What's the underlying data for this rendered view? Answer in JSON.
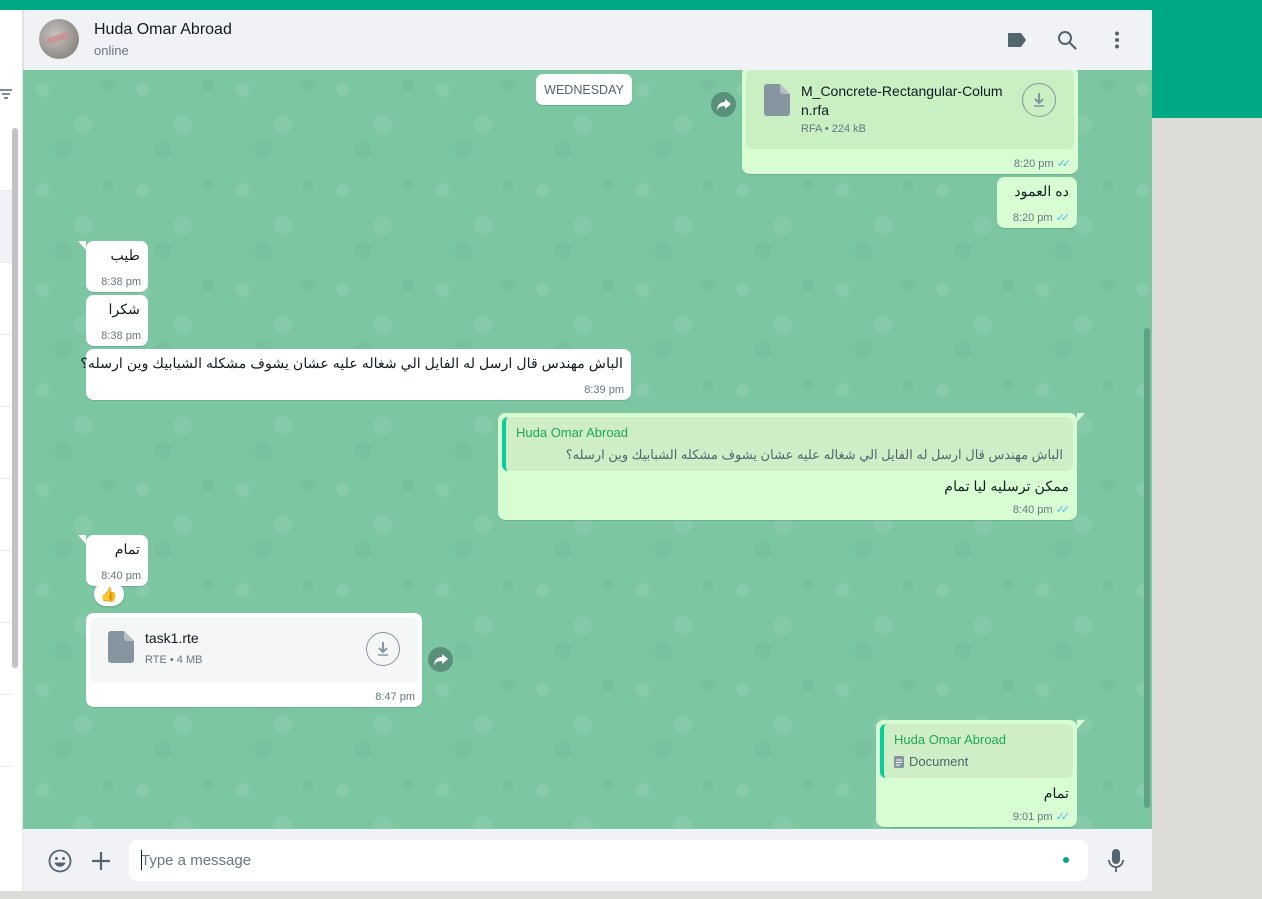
{
  "colors": {
    "accent": "#00a884",
    "incoming_bubble": "#ffffff",
    "outgoing_bubble": "#d9fdd3",
    "wallpaper": "#7cc6a2",
    "read_ticks": "#53bdeb",
    "quote_name": "#1fa855"
  },
  "header": {
    "contact_name": "Huda Omar Abroad",
    "status": "online",
    "icons": [
      "label-icon",
      "search-icon",
      "menu-icon"
    ]
  },
  "date_chip": "WEDNESDAY",
  "messages": [
    {
      "id": "m1",
      "direction": "out",
      "type": "document",
      "file_name_line1": "M_Concrete-Rectangular-Colum",
      "file_name_line2": "n.rfa",
      "file_info": "RFA • 224 kB",
      "time": "8:20 pm",
      "status": "read"
    },
    {
      "id": "m2",
      "direction": "out",
      "type": "text",
      "text": "ده العمود",
      "time": "8:20 pm",
      "status": "read"
    },
    {
      "id": "m3",
      "direction": "in",
      "type": "text",
      "text": "طيب",
      "time": "8:38 pm"
    },
    {
      "id": "m4",
      "direction": "in",
      "type": "text",
      "text": "شكرا",
      "time": "8:38 pm"
    },
    {
      "id": "m5",
      "direction": "in",
      "type": "text",
      "text": "الباش مهندس قال ارسل له الفايل الي شغاله عليه عشان يشوف مشكله الشبابيك وين ارسله؟",
      "time": "8:39 pm"
    },
    {
      "id": "m6",
      "direction": "out",
      "type": "reply",
      "quote_name": "Huda Omar Abroad",
      "quote_text": "الباش مهندس قال ارسل له الفايل الي شغاله عليه عشان يشوف مشكله الشبابيك وين ارسله؟",
      "text": "ممكن ترسليه ليا تمام",
      "time": "8:40 pm",
      "status": "read"
    },
    {
      "id": "m7",
      "direction": "in",
      "type": "text",
      "text": "تمام",
      "time": "8:40 pm",
      "reaction": "👍"
    },
    {
      "id": "m8",
      "direction": "in",
      "type": "document",
      "file_name": "task1.rte",
      "file_info": "RTE • 4 MB",
      "time": "8:47 pm"
    },
    {
      "id": "m9",
      "direction": "out",
      "type": "reply",
      "quote_name": "Huda Omar Abroad",
      "quote_text": "Document",
      "text": "تمام",
      "time": "9:01 pm",
      "status": "read"
    }
  ],
  "composer": {
    "placeholder": "Type a message",
    "value": "",
    "icons": [
      "emoji-icon",
      "attach-plus-icon",
      "microphone-icon"
    ]
  }
}
